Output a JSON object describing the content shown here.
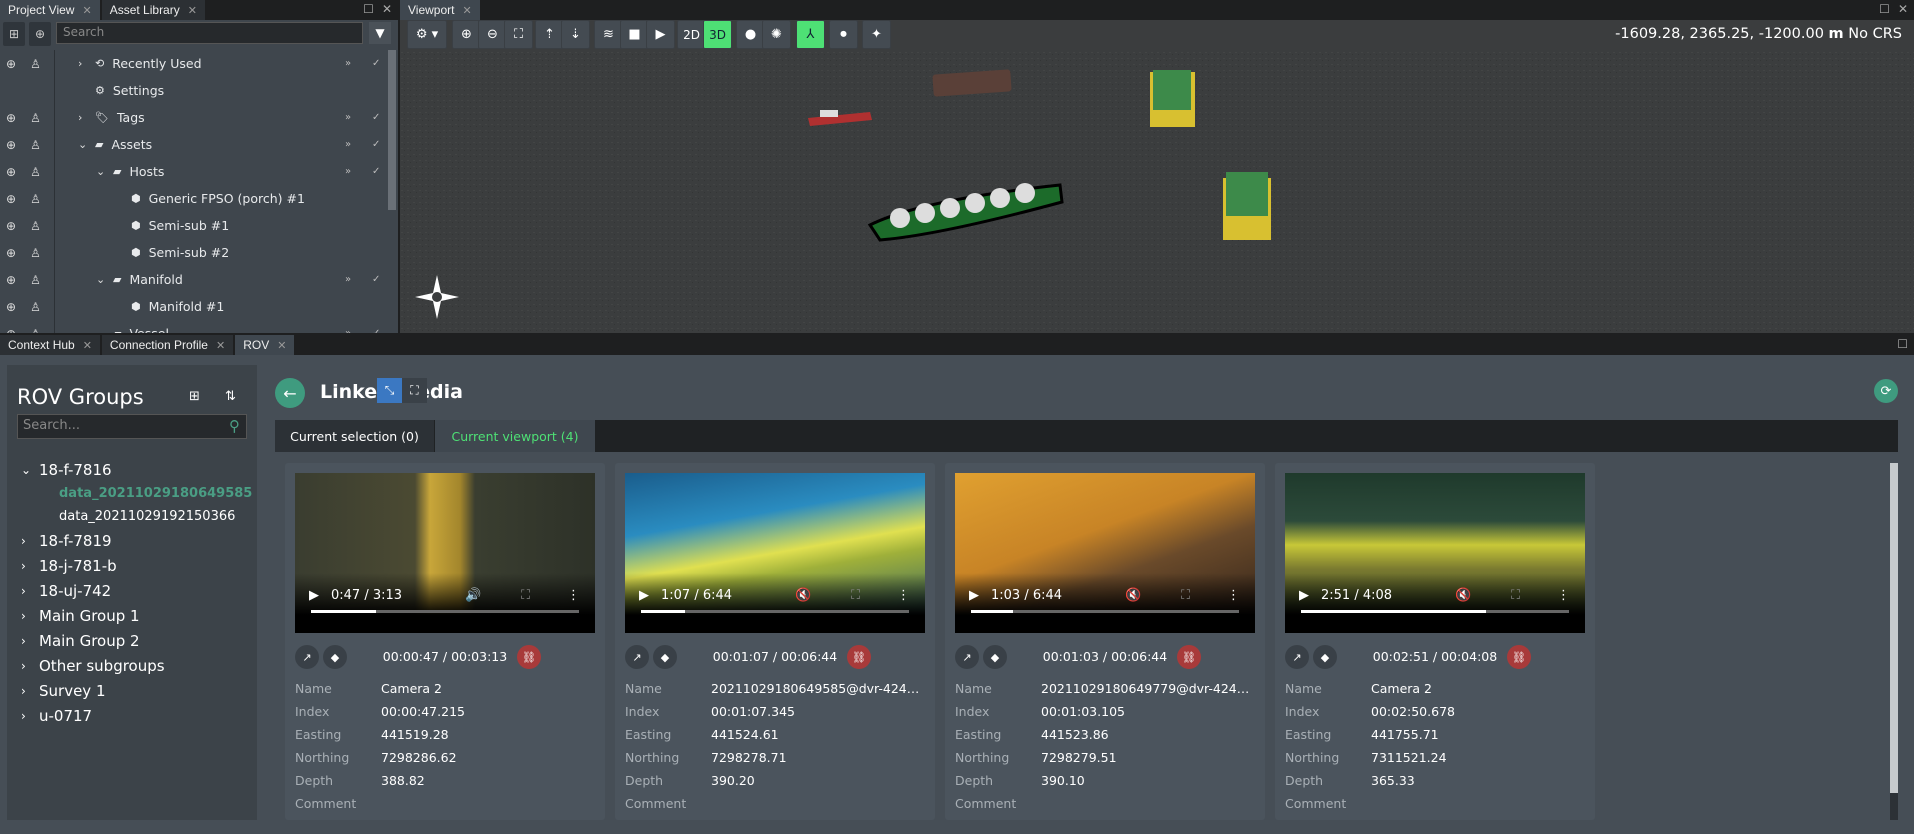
{
  "project_panel": {
    "tabs": [
      {
        "label": "Project View",
        "active": true
      },
      {
        "label": "Asset Library",
        "active": false
      }
    ],
    "search_placeholder": "Search",
    "tree": [
      {
        "label": "Recently Used",
        "icon": "history-icon",
        "level": 0,
        "expander": "collapsed",
        "vis": true
      },
      {
        "label": "Settings",
        "icon": "gear-icon",
        "level": 0,
        "expander": "none",
        "vis": false
      },
      {
        "label": "Tags",
        "icon": "tag-icon",
        "level": 0,
        "expander": "collapsed",
        "vis": true
      },
      {
        "label": "Assets",
        "icon": "folder-open-icon",
        "level": 0,
        "expander": "expanded",
        "vis": true
      },
      {
        "label": "Hosts",
        "icon": "folder-open-icon",
        "level": 1,
        "expander": "expanded",
        "vis": true
      },
      {
        "label": "Generic FPSO (porch) #1",
        "icon": "cube-icon",
        "level": 2,
        "expander": "none",
        "vis": true
      },
      {
        "label": "Semi-sub #1",
        "icon": "cube-icon",
        "level": 2,
        "expander": "none",
        "vis": true
      },
      {
        "label": "Semi-sub #2",
        "icon": "cube-icon",
        "level": 2,
        "expander": "none",
        "vis": true
      },
      {
        "label": "Manifold",
        "icon": "folder-open-icon",
        "level": 1,
        "expander": "expanded",
        "vis": true
      },
      {
        "label": "Manifold #1",
        "icon": "cube-icon",
        "level": 2,
        "expander": "none",
        "vis": true
      },
      {
        "label": "Vessel",
        "icon": "folder-open-icon",
        "level": 1,
        "expander": "expanded",
        "vis": true
      }
    ]
  },
  "viewport": {
    "tab": "Viewport",
    "coords": "-1609.28, 2365.25, -1200.00",
    "unit": "m",
    "crs": "No CRS",
    "toolbar": {
      "mode_2d": "2D",
      "mode_3d": "3D",
      "active_mode": "3D"
    },
    "accent": "#4ee075"
  },
  "bottom_tabs": [
    {
      "label": "Context Hub"
    },
    {
      "label": "Connection Profile"
    },
    {
      "label": "ROV",
      "active": true
    }
  ],
  "rov": {
    "title": "ROV Groups",
    "search_placeholder": "Search...",
    "groups": [
      {
        "label": "18-f-7816",
        "expanded": true,
        "children": [
          {
            "label": "data_20211029180649585",
            "selected": true
          },
          {
            "label": "data_20211029192150366"
          }
        ]
      },
      {
        "label": "18-f-7819"
      },
      {
        "label": "18-j-781-b"
      },
      {
        "label": "18-uj-742"
      },
      {
        "label": "Main Group 1"
      },
      {
        "label": "Main Group 2"
      },
      {
        "label": "Other subgroups"
      },
      {
        "label": "Survey 1"
      },
      {
        "label": "u-0717"
      }
    ],
    "selected_color": "#4a9e84"
  },
  "linked_media": {
    "title": "Linked media",
    "tabs": [
      {
        "label": "Current selection (0)"
      },
      {
        "label": "Current viewport (4)",
        "active": true
      }
    ],
    "field_labels": {
      "name": "Name",
      "index": "Index",
      "easting": "Easting",
      "northing": "Northing",
      "depth": "Depth",
      "comment": "Comment"
    },
    "cards": [
      {
        "player_time": "0:47 / 3:13",
        "progress": 0.243,
        "muted": false,
        "time": "00:00:47 / 00:03:13",
        "name": "Camera 2",
        "index": "00:00:47.215",
        "easting": "441519.28",
        "northing": "7298286.62",
        "depth": "388.82",
        "comment": ""
      },
      {
        "player_time": "1:07 / 6:44",
        "progress": 0.166,
        "muted": true,
        "time": "00:01:07 / 00:06:44",
        "name": "20211029180649585@dvr-4247...",
        "index": "00:01:07.345",
        "easting": "441524.61",
        "northing": "7298278.71",
        "depth": "390.20",
        "comment": ""
      },
      {
        "player_time": "1:03 / 6:44",
        "progress": 0.156,
        "muted": true,
        "time": "00:01:03 / 00:06:44",
        "name": "20211029180649779@dvr-4247...",
        "index": "00:01:03.105",
        "easting": "441523.86",
        "northing": "7298279.51",
        "depth": "390.10",
        "comment": ""
      },
      {
        "player_time": "2:51 / 4:08",
        "progress": 0.69,
        "muted": true,
        "time": "00:02:51 / 00:04:08",
        "name": "Camera 2",
        "index": "00:02:50.678",
        "easting": "441755.71",
        "northing": "7311521.24",
        "depth": "365.33",
        "comment": ""
      }
    ]
  }
}
